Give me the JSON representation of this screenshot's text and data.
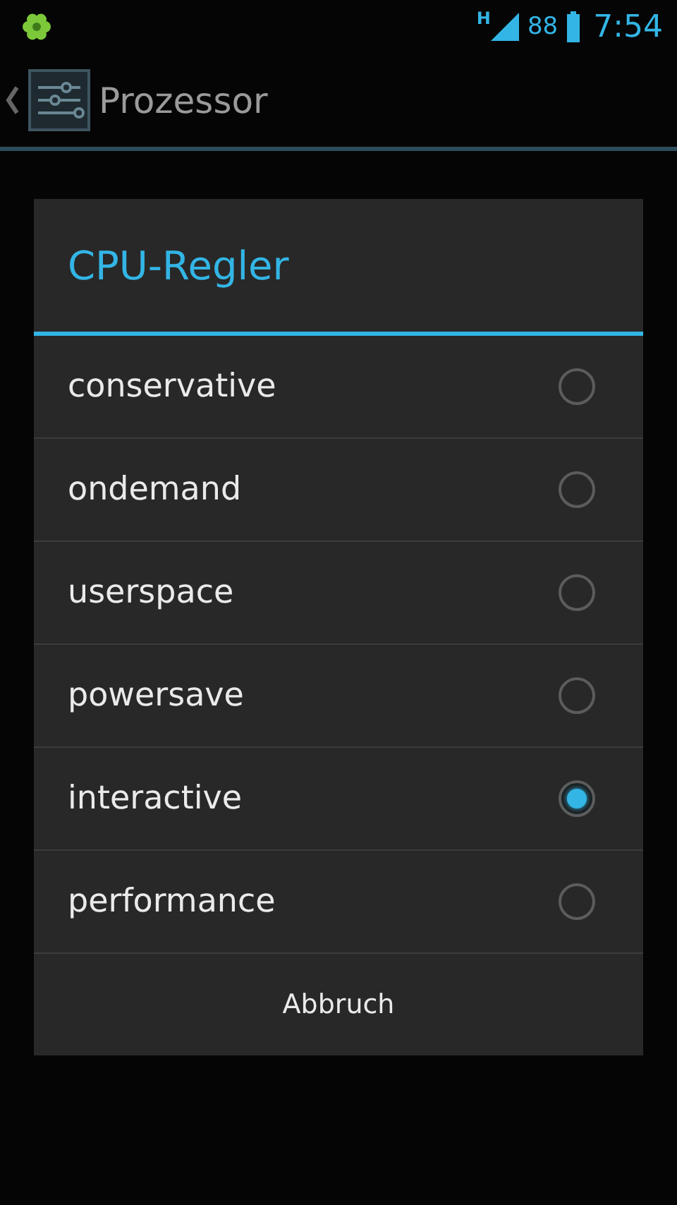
{
  "status_bar": {
    "network": "H",
    "battery": "88",
    "time": "7:54"
  },
  "action_bar": {
    "title": "Prozessor"
  },
  "dialog": {
    "title": "CPU-Regler",
    "options": [
      {
        "label": "conservative",
        "selected": false
      },
      {
        "label": "ondemand",
        "selected": false
      },
      {
        "label": "userspace",
        "selected": false
      },
      {
        "label": "powersave",
        "selected": false
      },
      {
        "label": "interactive",
        "selected": true
      },
      {
        "label": "performance",
        "selected": false
      }
    ],
    "cancel": "Abbruch"
  }
}
